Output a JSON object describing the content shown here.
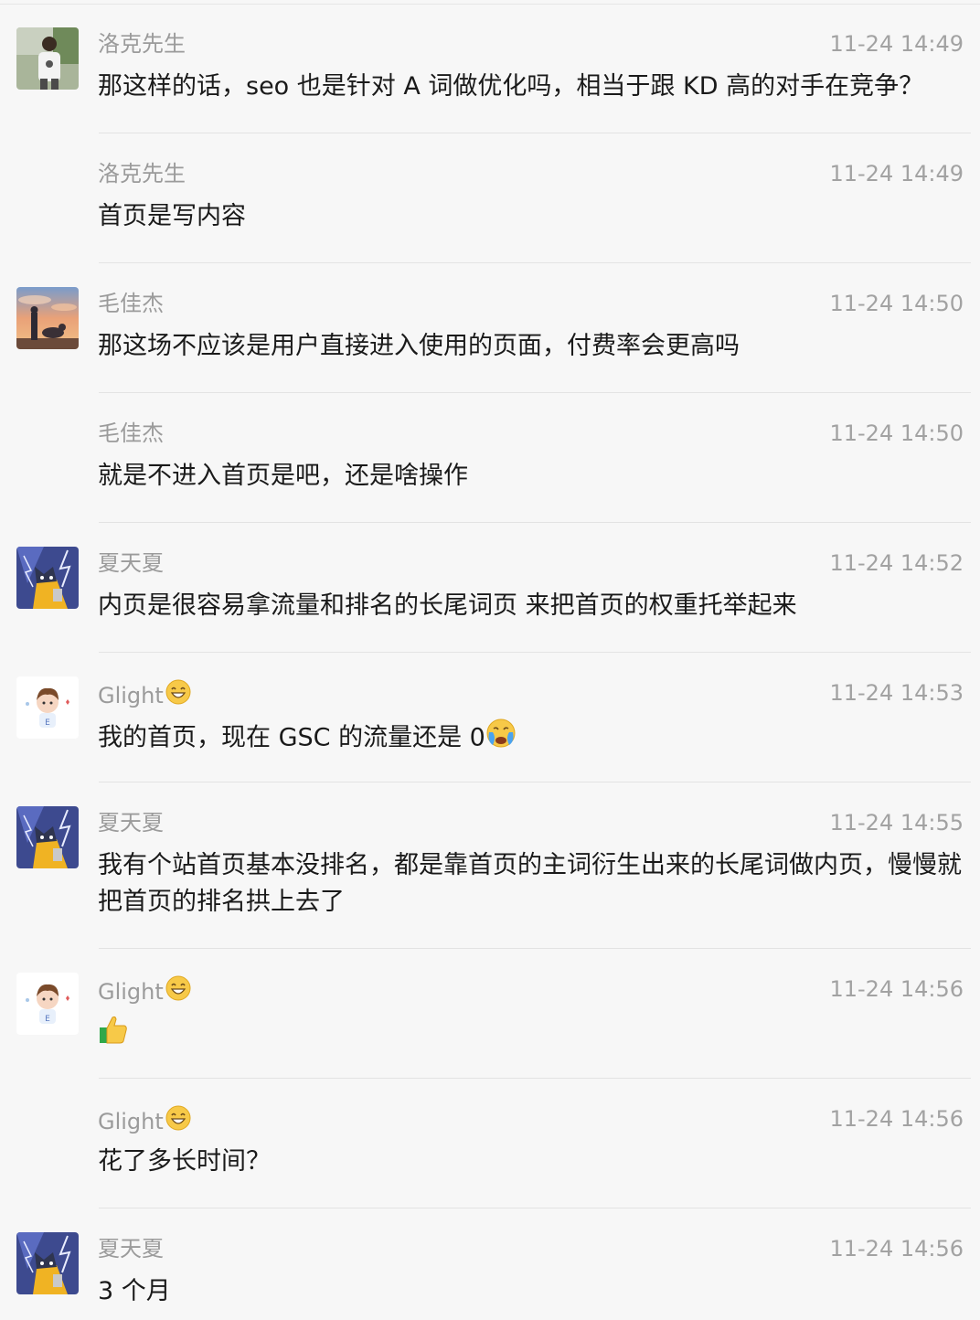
{
  "messages": [
    {
      "sender": "洛克先生",
      "time": "11-24 14:49",
      "text": "那这样的话，seo 也是针对 A 词做优化吗，相当于跟 KD 高的对手在竞争？",
      "avatar": "photo-man-avatar"
    },
    {
      "sender": "洛克先生",
      "time": "11-24 14:49",
      "text": "首页是写内容"
    },
    {
      "sender": "毛佳杰",
      "time": "11-24 14:50",
      "text": "那这场不应该是用户直接进入使用的页面，付费率会更高吗",
      "avatar": "sunset-dog-avatar"
    },
    {
      "sender": "毛佳杰",
      "time": "11-24 14:50",
      "text": "就是不进入首页是吧，还是啥操作"
    },
    {
      "sender": "夏天夏",
      "time": "11-24 14:52",
      "text": "内页是很容易拿流量和排名的长尾词页 来把首页的权重托举起来",
      "avatar": "anime-cat-avatar"
    },
    {
      "sender": "Glight",
      "sender_emoji": "grin-emoji",
      "time": "11-24 14:53",
      "text": "我的首页，现在 GSC 的流量还是 0",
      "text_emoji": "crying-emoji",
      "avatar": "cartoon-boy-avatar"
    },
    {
      "sender": "夏天夏",
      "time": "11-24 14:55",
      "text": "我有个站首页基本没排名，都是靠首页的主词衍生出来的长尾词做内页，慢慢就把首页的排名拱上去了",
      "avatar": "anime-cat-avatar"
    },
    {
      "sender": "Glight",
      "sender_emoji": "grin-emoji",
      "time": "11-24 14:56",
      "text": "",
      "text_emoji": "thumbs-up-emoji",
      "avatar": "cartoon-boy-avatar"
    },
    {
      "sender": "Glight",
      "sender_emoji": "grin-emoji",
      "time": "11-24 14:56",
      "text": "花了多长时间？"
    },
    {
      "sender": "夏天夏",
      "time": "11-24 14:56",
      "text": "3 个月",
      "avatar": "anime-cat-avatar"
    }
  ]
}
